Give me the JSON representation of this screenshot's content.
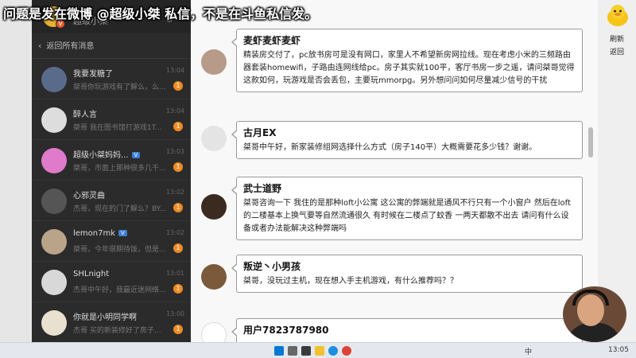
{
  "overlay_banner": "问题是发在微博 @超级小桀 私信，不是在斗鱼私信发。",
  "sidebar": {
    "username": "超级小桀",
    "badge": "V",
    "gear": "⚙",
    "back_label": "返回所有消息",
    "conversations": [
      {
        "name": "我要发糖了",
        "preview": "桀哥你玩游戏有了解么，么...",
        "time": "13:04",
        "badge": "1",
        "avatar": "#5a6a8a"
      },
      {
        "name": "醉人言",
        "preview": "桀哥 我在图书馆打游戏1T...",
        "time": "13:04",
        "badge": "1",
        "avatar": "#ddd"
      },
      {
        "name": "超级小桀妈妈...",
        "tag": "V",
        "preview": "桀哥，市面上那种很多几千...",
        "time": "13:03",
        "badge": "1",
        "avatar": "#e07acb"
      },
      {
        "name": "心邪灵曲",
        "preview": "杰哥，现在的门了解么？BY...",
        "time": "13:02",
        "badge": "1",
        "avatar": "#555"
      },
      {
        "name": "lemon7mk",
        "tag": "V",
        "preview": "桀哥，今年很期待饭，但是...",
        "time": "13:02",
        "badge": "1",
        "avatar": "#b9a48a"
      },
      {
        "name": "SHLnight",
        "preview": "杰哥中午好，我最近迷网络...",
        "time": "13:01",
        "badge": "1",
        "avatar": "#d8d8d8"
      },
      {
        "name": "你就是小明同学啊",
        "preview": "杰哥 买的新装修好了房子...",
        "time": "13:00",
        "badge": "1",
        "avatar": "#e9e0d0"
      }
    ]
  },
  "messages": [
    {
      "user": "麦虾麦虾麦虾",
      "text": "精装房交付了，pc放书房可是没有网口，家里人不希望新房网拉线。现在考虑小米的三频路由器套装homewifi，子路由连网线给pc。房子其实就100平，客厅书房一步之遥，请问桀哥觉得这款如何，玩游戏是否会丢包，主要玩mmorpg。另外想问问如何尽量减少信号的干扰",
      "avatar": "#b89a8a"
    },
    {
      "user": "古月EX",
      "text": "桀哥中午好，新家装修组网选择什么方式（房子140平）大概需要花多少钱？谢谢。",
      "avatar": "#e4e4e4"
    },
    {
      "user": "武士道野",
      "text": "桀哥咨询一下 我住的是那种loft小公寓 这公寓的弊端就是通风不行只有一个小窗户 然后在loft的二楼基本上换气要等自然流通很久 有时候在二楼点了蚊香 一两天都散不出去 请问有什么设备或者办法能解决这种弊端吗",
      "avatar": "#3a2a20"
    },
    {
      "user": "叛逆丶小男孩",
      "text": "桀哥，没玩过主机，现在想入手主机游戏，有什么推荐吗？？",
      "avatar": "#7a5a3a"
    },
    {
      "user": "用户7823787980",
      "text": "",
      "avatar": "#ffffff"
    }
  ],
  "rightbar": {
    "refresh": "刷新",
    "back": "返回"
  },
  "taskbar": {
    "tray_lang": "中",
    "time": "13:05"
  },
  "colors": {
    "sidebar_bg": "#2b2b2b",
    "badge_orange": "#f08a24",
    "vip_blue": "#3d7fd6"
  }
}
